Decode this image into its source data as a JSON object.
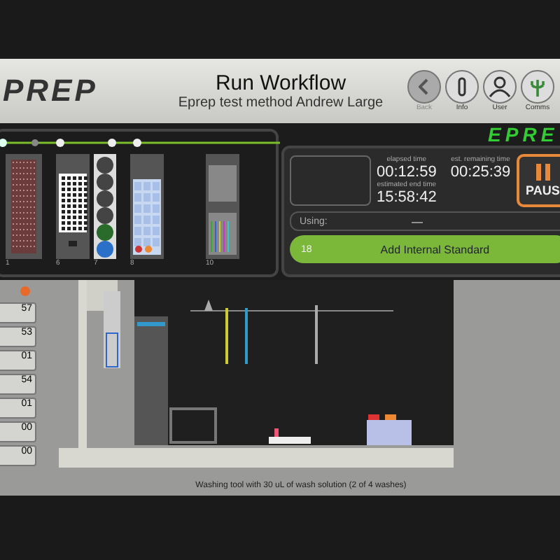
{
  "header": {
    "logo": "PREP",
    "title": "Run Workflow",
    "subtitle": "Eprep test method Andrew Large",
    "buttons": [
      {
        "label": "Back",
        "kind": "back",
        "disabled": true
      },
      {
        "label": "Info",
        "kind": "info",
        "disabled": false
      },
      {
        "label": "User",
        "kind": "user",
        "disabled": false
      },
      {
        "label": "Comms",
        "kind": "comms",
        "disabled": false
      }
    ]
  },
  "deck": {
    "trays": [
      {
        "kind": "plate",
        "label": "1"
      },
      {
        "kind": "grid",
        "label": "6"
      },
      {
        "kind": "vials",
        "label": "7"
      },
      {
        "kind": "rack",
        "label": "8"
      },
      {
        "kind": "tubes",
        "label": "10"
      }
    ]
  },
  "run": {
    "logo": "EPRE",
    "timers": [
      {
        "label": "elapsed time",
        "value": "00:12:59"
      },
      {
        "label": "est. remaining time",
        "value": "00:25:39"
      },
      {
        "label": "estimated end time",
        "value": "15:58:42"
      }
    ],
    "pause_button": "PAUS",
    "using": {
      "label": "Using:",
      "value": "—"
    },
    "step": {
      "number": "18",
      "label": "Add Internal Standard"
    }
  },
  "side_values": [
    "57",
    "53",
    "01",
    "54",
    "01",
    "00",
    "00"
  ],
  "status": "Washing tool with 30 uL of wash solution (2 of 4 washes)"
}
